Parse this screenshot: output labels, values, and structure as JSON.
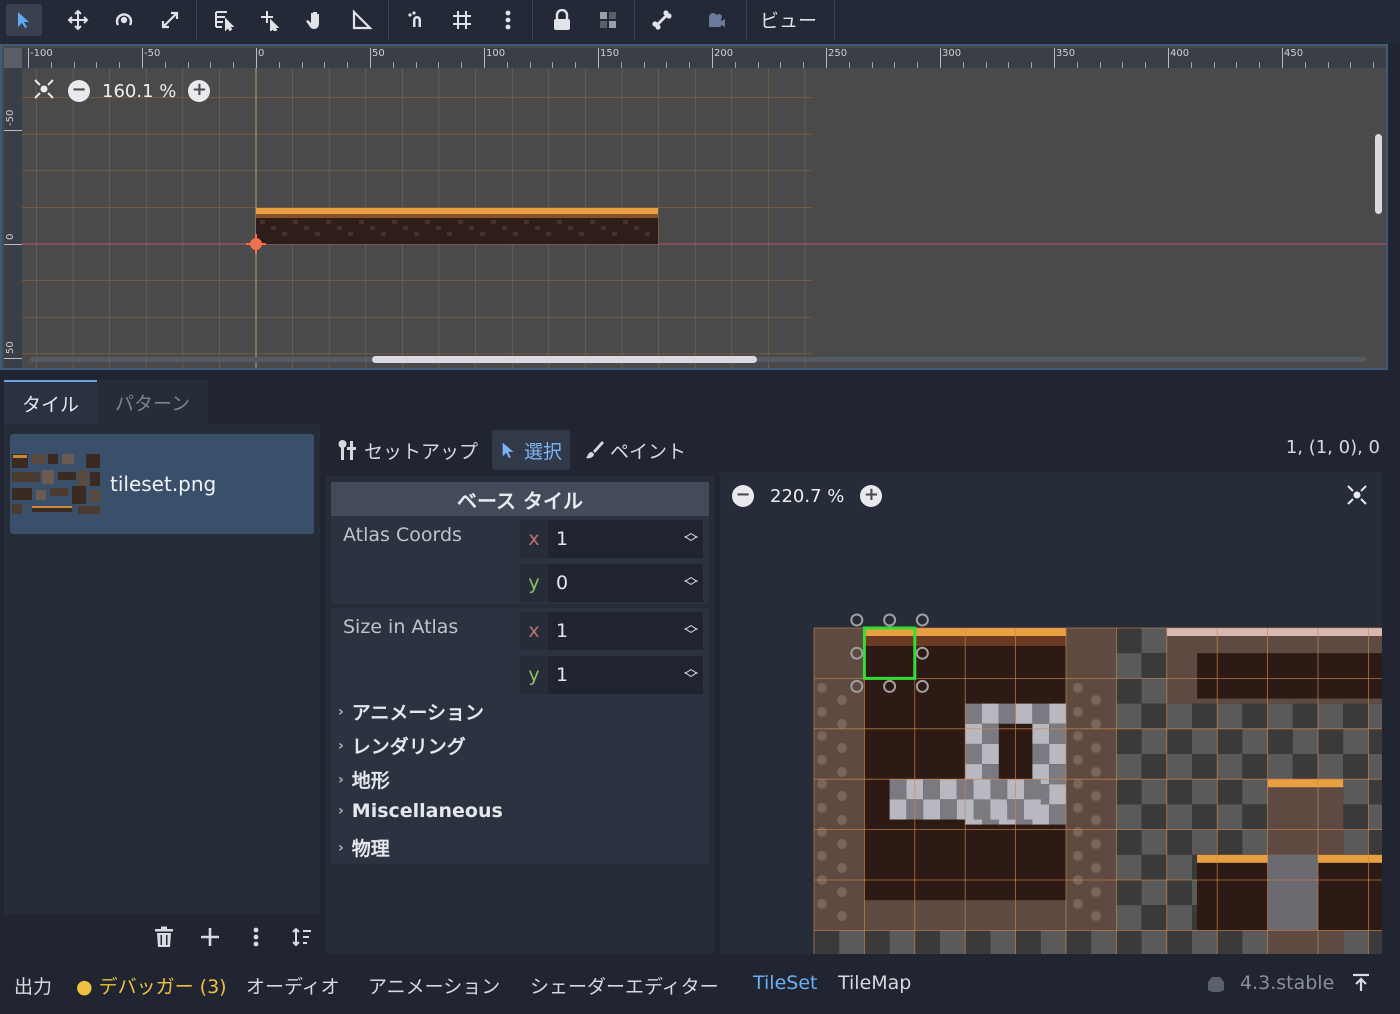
{
  "toolbar": {
    "tools": [
      "select-icon",
      "move-icon",
      "rotate-icon",
      "scale-icon",
      "list-select-icon",
      "pivot-icon",
      "pan-icon",
      "ruler-icon",
      "smart-snap-icon",
      "grid-snap-icon",
      "more-icon",
      "lock-icon",
      "group-icon",
      "bone-icon",
      "camera-icon"
    ],
    "view_label": "ビュー"
  },
  "viewport": {
    "zoom": "160.1 %",
    "ruler_top": [
      "-100",
      "-50",
      "0",
      "50",
      "100",
      "150",
      "200",
      "250",
      "300",
      "350",
      "400",
      "450"
    ],
    "ruler_left": [
      "-50",
      "0",
      "50"
    ]
  },
  "tabs": {
    "tiles": "タイル",
    "patterns": "パターン"
  },
  "sources": {
    "items": [
      {
        "name": "tileset.png"
      }
    ]
  },
  "modes": {
    "setup": "セットアップ",
    "select": "選択",
    "paint": "ペイント"
  },
  "coords_readout": "1, (1, 0), 0",
  "inspector": {
    "header": "ベース タイル",
    "atlas_coords": {
      "label": "Atlas Coords",
      "x": "1",
      "y": "0"
    },
    "size_in_atlas": {
      "label": "Size in Atlas",
      "x": "1",
      "y": "1"
    },
    "axis_x": "x",
    "axis_y": "y",
    "sections": [
      "アニメーション",
      "レンダリング",
      "地形",
      "Miscellaneous",
      "物理"
    ]
  },
  "atlas_view": {
    "zoom": "220.7 %"
  },
  "bottom_bar": {
    "output": "出力",
    "debugger": "デバッガー (3)",
    "audio": "オーディオ",
    "animation": "アニメーション",
    "shader": "シェーダーエディター",
    "tileset": "TileSet",
    "tilemap": "TileMap",
    "version": "4.3.stable"
  },
  "colors": {
    "accent": "#6ab0f0",
    "selection": "#33dd33",
    "debugger": "#f0c040"
  }
}
